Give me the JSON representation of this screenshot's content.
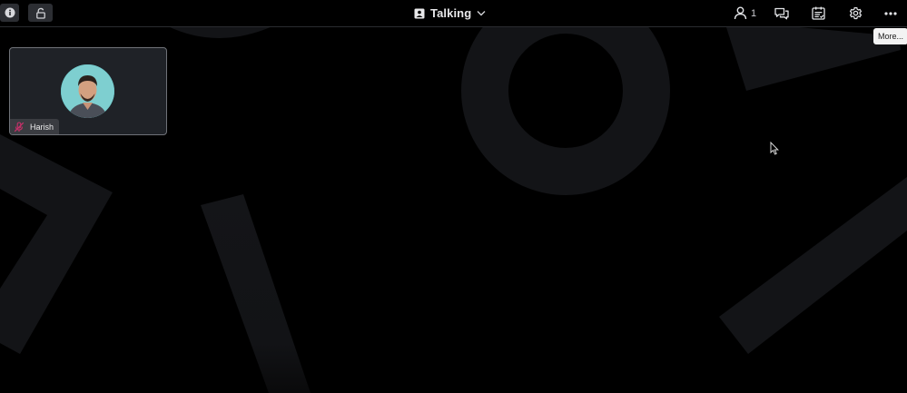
{
  "topbar": {
    "info_label": "",
    "title": "Talking",
    "participant_count": "1",
    "tooltip": "More..."
  },
  "participants": [
    {
      "name": "Harish",
      "muted": true
    }
  ],
  "colors": {
    "background": "#000000",
    "shape": "#121316",
    "tile_bg": "#1f2227",
    "mute_accent": "#c9306a"
  },
  "icons": {
    "info": "info-icon",
    "lock": "lock-icon",
    "title": "presentation-icon",
    "chevron": "chevron-down-icon",
    "participants": "person-icon",
    "chat": "chat-icon",
    "polls": "checklist-icon",
    "settings": "gear-icon",
    "more": "more-horizontal-icon",
    "mute": "microphone-off-icon"
  }
}
